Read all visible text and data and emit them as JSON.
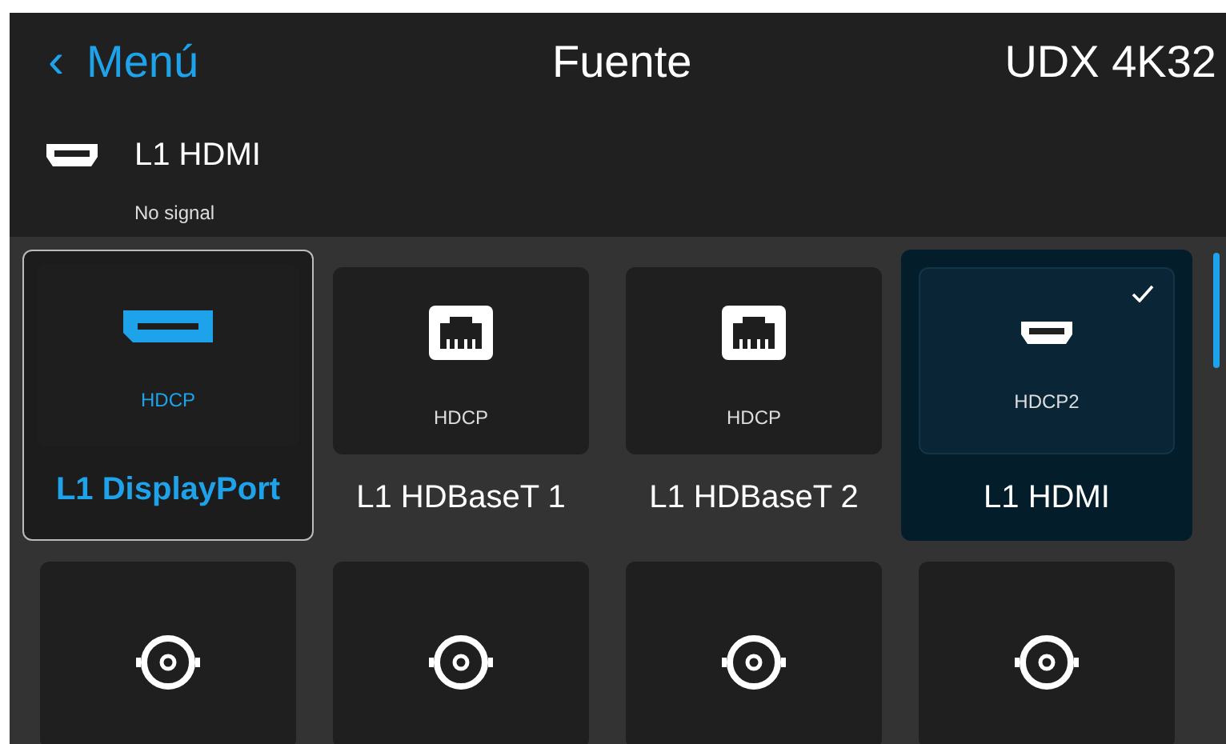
{
  "header": {
    "back_icon": "‹",
    "back_label": "Menú",
    "title": "Fuente",
    "device": "UDX 4K32"
  },
  "current_source": {
    "kind": "hdmi",
    "name": "L1 HDMI",
    "status": "No signal"
  },
  "sources": [
    {
      "kind": "displayport",
      "badge": "HDCP",
      "label": "L1 DisplayPort",
      "focused": true,
      "selected": false
    },
    {
      "kind": "rj45",
      "badge": "HDCP",
      "label": "L1 HDBaseT 1",
      "focused": false,
      "selected": false
    },
    {
      "kind": "rj45",
      "badge": "HDCP",
      "label": "L1 HDBaseT 2",
      "focused": false,
      "selected": false
    },
    {
      "kind": "hdmi",
      "badge": "HDCP2",
      "label": "L1 HDMI",
      "focused": false,
      "selected": true
    },
    {
      "kind": "bnc",
      "focused": false,
      "selected": false
    },
    {
      "kind": "bnc",
      "focused": false,
      "selected": false
    },
    {
      "kind": "bnc",
      "focused": false,
      "selected": false
    },
    {
      "kind": "bnc",
      "focused": false,
      "selected": false
    }
  ]
}
